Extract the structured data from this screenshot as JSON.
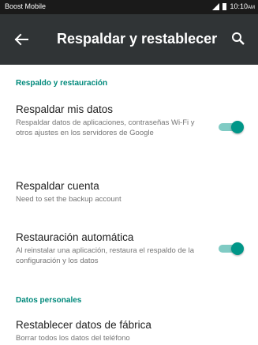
{
  "status_bar": {
    "carrier": "Boost Mobile",
    "time": "10:10",
    "time_suffix": "AM",
    "icons": [
      "signal-icon",
      "battery-icon"
    ]
  },
  "app_bar": {
    "title": "Respaldar y restablecer",
    "back_icon": "back-arrow-icon",
    "search_icon": "search-icon"
  },
  "sections": {
    "backup": {
      "header": "Respaldo y restauración",
      "items": [
        {
          "title": "Respaldar mis datos",
          "subtitle": "Respaldar datos de aplicaciones, contraseñas Wi-Fi y otros ajustes en los servidores de Google",
          "toggle": true
        },
        {
          "title": "Respaldar cuenta",
          "subtitle": "Need to set the backup account"
        },
        {
          "title": "Restauración automática",
          "subtitle": "Al reinstalar una aplicación, restaura el respaldo de la configuración y los datos",
          "toggle": true
        }
      ]
    },
    "personal": {
      "header": "Datos personales",
      "items": [
        {
          "title": "Restablecer datos de fábrica",
          "subtitle": "Borrar todos los datos del teléfono"
        }
      ]
    }
  },
  "colors": {
    "accent": "#00897b",
    "toggle_on": "#009688",
    "toggle_track": "#80cbc4",
    "app_bar": "#303436",
    "status_bar": "#1a1a1a"
  }
}
